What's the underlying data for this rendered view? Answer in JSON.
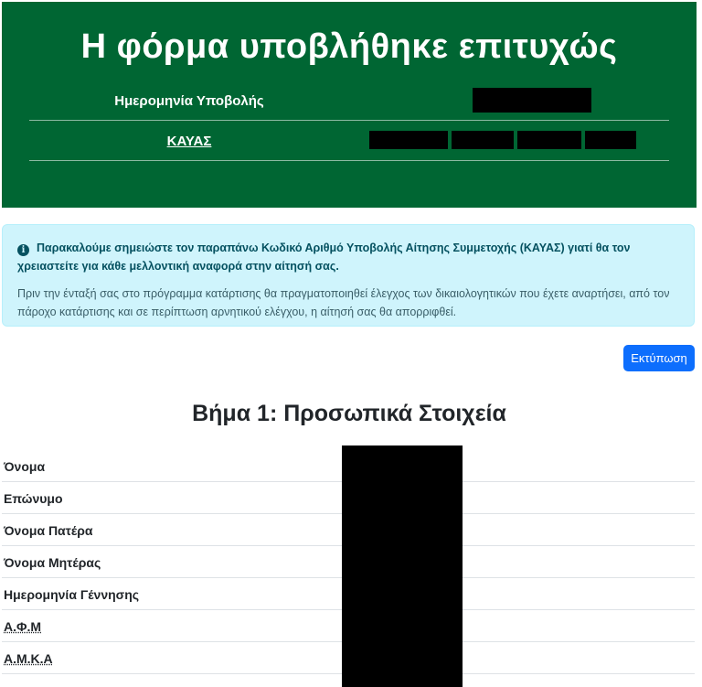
{
  "header": {
    "title": "Η φόρμα υποβλήθηκε επιτυχώς",
    "submission_date_label": "Ημερομηνία Υποβολής",
    "kayas_label": "ΚΑΥΑΣ"
  },
  "alert": {
    "icon": "info-circle-icon",
    "strong_text": "Παρακαλούμε σημειώστε τον παραπάνω Κωδικό Αριθμό Υποβολής Αίτησης Συμμετοχής (ΚΑΥΑΣ) γιατί θα τον χρειαστείτε για κάθε μελλοντική αναφορά στην αίτησή σας.",
    "body_text": "Πριν την ένταξή σας στο πρόγραμμα κατάρτισης θα πραγματοποιηθεί έλεγχος των δικαιολογητικών που έχετε αναρτήσει, από τον πάροχο κατάρτισης και σε περίπτωση αρνητικού ελέγχου, η αίτησή σας θα απορριφθεί."
  },
  "actions": {
    "print_label": "Εκτύπωση"
  },
  "step": {
    "title": "Βήμα 1: Προσωπικά Στοιχεία",
    "rows": [
      {
        "label": "Όνομα",
        "value": ""
      },
      {
        "label": "Επώνυμο",
        "value": ""
      },
      {
        "label": "Όνομα Πατέρα",
        "value": ""
      },
      {
        "label": "Όνομα Μητέρας",
        "value": ""
      },
      {
        "label": "Ημερομηνία Γέννησης",
        "value": ""
      },
      {
        "label": "Α.Φ.Μ",
        "value": ""
      },
      {
        "label": "Α.Μ.Κ.Α",
        "value": ""
      }
    ]
  },
  "colors": {
    "header_bg": "#006633",
    "alert_bg": "#cff4fc",
    "alert_text": "#055160",
    "primary_button": "#0d6efd"
  }
}
